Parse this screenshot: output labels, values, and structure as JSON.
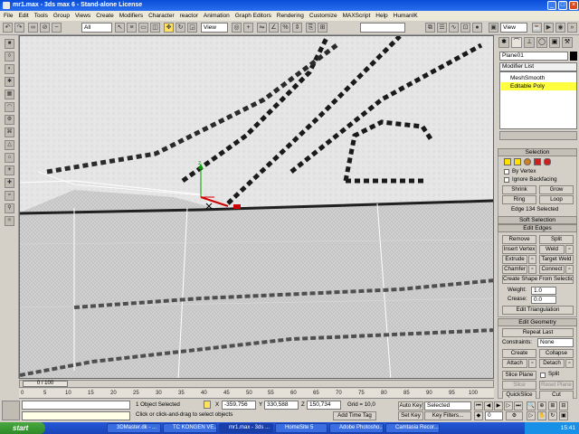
{
  "window": {
    "title": "mr1.max - 3ds max 6 - Stand-alone License"
  },
  "menu": [
    "File",
    "Edit",
    "Tools",
    "Group",
    "Views",
    "Create",
    "Modifiers",
    "Character",
    "reactor",
    "Animation",
    "Graph Editors",
    "Rendering",
    "Customize",
    "MAXScript",
    "Help",
    "HumanIK"
  ],
  "toolbar": {
    "selection_filter": "All",
    "ref_coord": "View",
    "ref_coord2": "View"
  },
  "command_panel": {
    "object_name": "Plane01",
    "modifier_list": "Modifier List",
    "stack": [
      "MeshSmooth",
      "Editable Poly"
    ],
    "selection": {
      "header": "Selection",
      "by_vertex": "By Vertex",
      "ignore_backfacing": "Ignore Backfacing",
      "shrink": "Shrink",
      "grow": "Grow",
      "ring": "Ring",
      "loop": "Loop",
      "status": "Edge 134 Selected"
    },
    "soft_selection": {
      "header": "Soft Selection"
    },
    "edit_edges": {
      "header": "Edit Edges",
      "remove": "Remove",
      "split": "Split",
      "insert_vertex": "Insert Vertex",
      "weld": "Weld",
      "extrude": "Extrude",
      "target_weld": "Target Weld",
      "chamfer": "Chamfer",
      "connect": "Connect",
      "create_shape": "Create Shape From Selection",
      "weight_label": "Weight:",
      "weight_value": "1.0",
      "crease_label": "Crease:",
      "crease_value": "0.0",
      "edit_triangulation": "Edit Triangulation"
    },
    "edit_geometry": {
      "header": "Edit Geometry",
      "repeat_last": "Repeat Last",
      "constraints_label": "Constraints:",
      "constraints_value": "None",
      "create": "Create",
      "collapse": "Collapse",
      "attach": "Attach",
      "detach": "Detach",
      "slice_plane": "Slice Plane",
      "split": "Split",
      "slice": "Slice",
      "reset_plane": "Reset Plane",
      "quickslice": "QuickSlice",
      "cut": "Cut"
    }
  },
  "timeline": {
    "slider_label": "0 / 100",
    "ticks": [
      "0",
      "5",
      "10",
      "15",
      "20",
      "25",
      "30",
      "35",
      "40",
      "45",
      "50",
      "55",
      "60",
      "65",
      "70",
      "75",
      "80",
      "85",
      "90",
      "95",
      "100"
    ]
  },
  "status": {
    "selected": "1 Object Selected",
    "prompt": "Click or click-and-drag to select objects",
    "x_label": "X",
    "x": "-359,756",
    "y_label": "Y",
    "y": "330,588",
    "z_label": "Z",
    "z": "150,734",
    "grid": "Grid = 10,0",
    "add_time_tag": "Add Time Tag",
    "auto_key": "Auto Key",
    "set_key": "Set Key",
    "key_mode": "Selected",
    "key_filters": "Key Filters...",
    "frame": "0"
  },
  "taskbar": {
    "start": "start",
    "tasks": [
      "3DMaster.dk - ...",
      "TC KONGEN VE...",
      "mr1.max - 3ds ...",
      "HomeSite 5",
      "Adobe Photosho...",
      "Camtasia Recor..."
    ],
    "clock": "15:41"
  },
  "colors": {
    "selected_edge": "#cc0000",
    "highlight_yellow": "#ffff40",
    "taskbar_blue": "#2458d8"
  }
}
